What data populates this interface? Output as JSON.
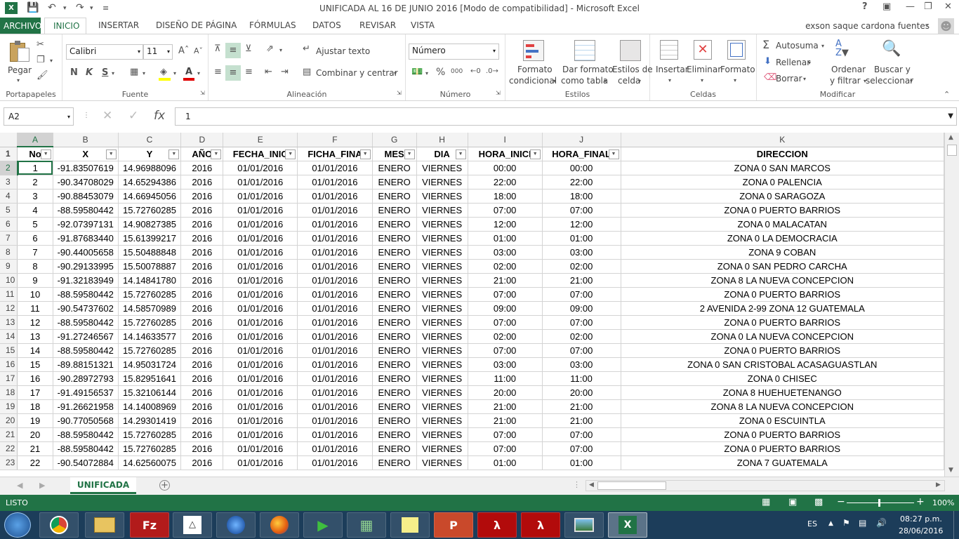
{
  "window": {
    "title": "UNIFICADA AL 16 DE JUNIO 2016  [Modo de compatibilidad] - Microsoft Excel",
    "user": "exson saque cardona fuentes"
  },
  "tabs": [
    "ARCHIVO",
    "INICIO",
    "INSERTAR",
    "DISEÑO DE PÁGINA",
    "FÓRMULAS",
    "DATOS",
    "REVISAR",
    "VISTA"
  ],
  "ribbon": {
    "portapapeles": {
      "pegar": "Pegar",
      "label": "Portapapeles"
    },
    "fuente": {
      "font": "Calibri",
      "size": "11",
      "bold": "N",
      "italic": "K",
      "underline": "S",
      "label": "Fuente"
    },
    "alineacion": {
      "wrap": "Ajustar texto",
      "merge": "Combinar y centrar",
      "label": "Alineación"
    },
    "numero": {
      "format": "Número",
      "label": "Número"
    },
    "estilos": {
      "cond1": "Formato",
      "cond2": "condicional",
      "table1": "Dar formato",
      "table2": "como tabla",
      "cell1": "Estilos de",
      "cell2": "celda",
      "label": "Estilos"
    },
    "celdas": {
      "insert": "Insertar",
      "delete": "Eliminar",
      "format": "Formato",
      "label": "Celdas"
    },
    "modificar": {
      "autosum": "Autosuma",
      "fill": "Rellenar",
      "clear": "Borrar",
      "sort1": "Ordenar",
      "sort2": "y filtrar",
      "find1": "Buscar y",
      "find2": "seleccionar",
      "label": "Modificar"
    }
  },
  "formula_bar": {
    "name_box": "A2",
    "fx": "fx",
    "value": "1"
  },
  "columns": [
    "A",
    "B",
    "C",
    "D",
    "E",
    "F",
    "G",
    "H",
    "I",
    "J",
    "K"
  ],
  "headers": [
    "No",
    "X",
    "Y",
    "AÑO",
    "FECHA_INIC",
    "FICHA_FINA",
    "MES",
    "DIA",
    "HORA_INICI",
    "HORA_FINAL",
    "DIRECCION"
  ],
  "rows": [
    [
      "1",
      "-91.83507619",
      "14.96988096",
      "2016",
      "01/01/2016",
      "01/01/2016",
      "ENERO",
      "VIERNES",
      "00:00",
      "00:00",
      "ZONA 0 SAN MARCOS"
    ],
    [
      "2",
      "-90.34708029",
      "14.65294386",
      "2016",
      "01/01/2016",
      "01/01/2016",
      "ENERO",
      "VIERNES",
      "22:00",
      "22:00",
      "ZONA 0 PALENCIA"
    ],
    [
      "3",
      "-90.88453079",
      "14.66945056",
      "2016",
      "01/01/2016",
      "01/01/2016",
      "ENERO",
      "VIERNES",
      "18:00",
      "18:00",
      "ZONA 0 SARAGOZA"
    ],
    [
      "4",
      "-88.59580442",
      "15.72760285",
      "2016",
      "01/01/2016",
      "01/01/2016",
      "ENERO",
      "VIERNES",
      "07:00",
      "07:00",
      "ZONA 0 PUERTO BARRIOS"
    ],
    [
      "5",
      "-92.07397131",
      "14.90827385",
      "2016",
      "01/01/2016",
      "01/01/2016",
      "ENERO",
      "VIERNES",
      "12:00",
      "12:00",
      "ZONA 0 MALACATAN"
    ],
    [
      "6",
      "-91.87683440",
      "15.61399217",
      "2016",
      "01/01/2016",
      "01/01/2016",
      "ENERO",
      "VIERNES",
      "01:00",
      "01:00",
      "ZONA 0 LA DEMOCRACIA"
    ],
    [
      "7",
      "-90.44005658",
      "15.50488848",
      "2016",
      "01/01/2016",
      "01/01/2016",
      "ENERO",
      "VIERNES",
      "03:00",
      "03:00",
      "ZONA 9 COBAN"
    ],
    [
      "8",
      "-90.29133995",
      "15.50078887",
      "2016",
      "01/01/2016",
      "01/01/2016",
      "ENERO",
      "VIERNES",
      "02:00",
      "02:00",
      "ZONA 0 SAN PEDRO CARCHA"
    ],
    [
      "9",
      "-91.32183949",
      "14.14841780",
      "2016",
      "01/01/2016",
      "01/01/2016",
      "ENERO",
      "VIERNES",
      "21:00",
      "21:00",
      "ZONA 8 LA NUEVA CONCEPCION"
    ],
    [
      "10",
      "-88.59580442",
      "15.72760285",
      "2016",
      "01/01/2016",
      "01/01/2016",
      "ENERO",
      "VIERNES",
      "07:00",
      "07:00",
      "ZONA 0 PUERTO BARRIOS"
    ],
    [
      "11",
      "-90.54737602",
      "14.58570989",
      "2016",
      "01/01/2016",
      "01/01/2016",
      "ENERO",
      "VIERNES",
      "09:00",
      "09:00",
      "2 AVENIDA 2-99 ZONA 12 GUATEMALA"
    ],
    [
      "12",
      "-88.59580442",
      "15.72760285",
      "2016",
      "01/01/2016",
      "01/01/2016",
      "ENERO",
      "VIERNES",
      "07:00",
      "07:00",
      "ZONA 0 PUERTO BARRIOS"
    ],
    [
      "13",
      "-91.27246567",
      "14.14633577",
      "2016",
      "01/01/2016",
      "01/01/2016",
      "ENERO",
      "VIERNES",
      "02:00",
      "02:00",
      "ZONA 0 LA NUEVA CONCEPCION"
    ],
    [
      "14",
      "-88.59580442",
      "15.72760285",
      "2016",
      "01/01/2016",
      "01/01/2016",
      "ENERO",
      "VIERNES",
      "07:00",
      "07:00",
      "ZONA 0 PUERTO BARRIOS"
    ],
    [
      "15",
      "-89.88151321",
      "14.95031724",
      "2016",
      "01/01/2016",
      "01/01/2016",
      "ENERO",
      "VIERNES",
      "03:00",
      "03:00",
      "ZONA 0 SAN CRISTOBAL ACASAGUASTLAN"
    ],
    [
      "16",
      "-90.28972793",
      "15.82951641",
      "2016",
      "01/01/2016",
      "01/01/2016",
      "ENERO",
      "VIERNES",
      "11:00",
      "11:00",
      "ZONA 0 CHISEC"
    ],
    [
      "17",
      "-91.49156537",
      "15.32106144",
      "2016",
      "01/01/2016",
      "01/01/2016",
      "ENERO",
      "VIERNES",
      "20:00",
      "20:00",
      "ZONA 8 HUEHUETENANGO"
    ],
    [
      "18",
      "-91.26621958",
      "14.14008969",
      "2016",
      "01/01/2016",
      "01/01/2016",
      "ENERO",
      "VIERNES",
      "21:00",
      "21:00",
      "ZONA 8 LA NUEVA CONCEPCION"
    ],
    [
      "19",
      "-90.77050568",
      "14.29301419",
      "2016",
      "01/01/2016",
      "01/01/2016",
      "ENERO",
      "VIERNES",
      "21:00",
      "21:00",
      "ZONA 0 ESCUINTLA"
    ],
    [
      "20",
      "-88.59580442",
      "15.72760285",
      "2016",
      "01/01/2016",
      "01/01/2016",
      "ENERO",
      "VIERNES",
      "07:00",
      "07:00",
      "ZONA 0 PUERTO BARRIOS"
    ],
    [
      "21",
      "-88.59580442",
      "15.72760285",
      "2016",
      "01/01/2016",
      "01/01/2016",
      "ENERO",
      "VIERNES",
      "07:00",
      "07:00",
      "ZONA 0 PUERTO BARRIOS"
    ],
    [
      "22",
      "-90.54072884",
      "14.62560075",
      "2016",
      "01/01/2016",
      "01/01/2016",
      "ENERO",
      "VIERNES",
      "01:00",
      "01:00",
      "ZONA 7 GUATEMALA"
    ]
  ],
  "sheet": {
    "tab": "UNIFICADA"
  },
  "status": {
    "mode": "LISTO",
    "zoom": "100%"
  },
  "taskbar": {
    "lang": "ES",
    "time": "08:27 p.m.",
    "date": "28/06/2016"
  },
  "colors": {
    "accent": "#217346"
  }
}
